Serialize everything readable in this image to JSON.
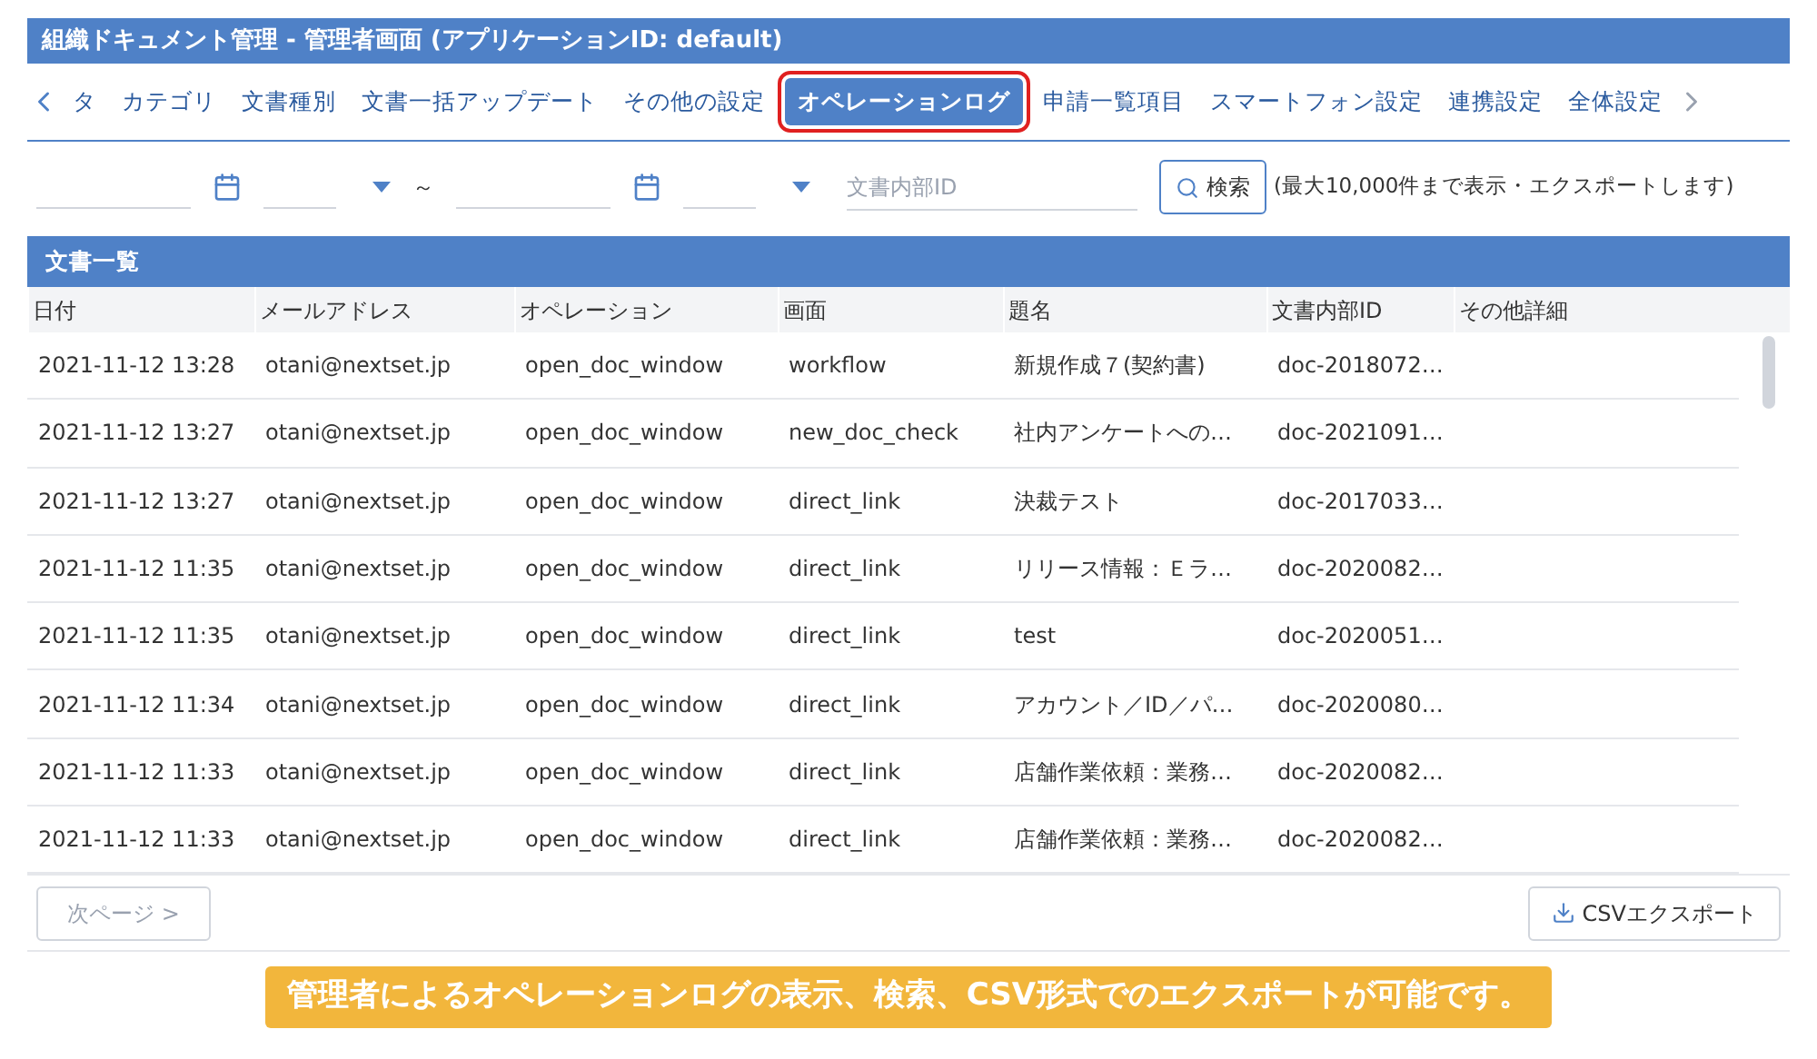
{
  "window": {
    "title": "組織ドキュメント管理 - 管理者画面 (アプリケーションID: default)"
  },
  "tabs": [
    {
      "label": "タ",
      "selected": false
    },
    {
      "label": "カテゴリ",
      "selected": false
    },
    {
      "label": "文書種別",
      "selected": false
    },
    {
      "label": "文書一括アップデート",
      "selected": false
    },
    {
      "label": "その他の設定",
      "selected": false
    },
    {
      "label": "オペレーションログ",
      "selected": true
    },
    {
      "label": "申請一覧項目",
      "selected": false
    },
    {
      "label": "スマートフォン設定",
      "selected": false
    },
    {
      "label": "連携設定",
      "selected": false
    },
    {
      "label": "全体設定",
      "selected": false
    }
  ],
  "filter": {
    "range_separator": "～",
    "doc_id": {
      "placeholder": "文書内部ID"
    },
    "search_button": "検索",
    "note": "(最大10,000件まで表示・エクスポートします)"
  },
  "table": {
    "title": "文書一覧",
    "columns": [
      "日付",
      "メールアドレス",
      "オペレーション",
      "画面",
      "題名",
      "文書内部ID",
      "その他詳細"
    ],
    "rows": [
      [
        "2021-11-12 13:28",
        "otani@nextset.jp",
        "open_doc_window",
        "workflow",
        "新規作成７(契約書)",
        "doc-2018072…"
      ],
      [
        "2021-11-12 13:27",
        "otani@nextset.jp",
        "open_doc_window",
        "new_doc_check",
        "社内アンケートへの…",
        "doc-2021091…"
      ],
      [
        "2021-11-12 13:27",
        "otani@nextset.jp",
        "open_doc_window",
        "direct_link",
        "決裁テスト",
        "doc-2017033…"
      ],
      [
        "2021-11-12 11:35",
        "otani@nextset.jp",
        "open_doc_window",
        "direct_link",
        "リリース情報：Ｅラ…",
        "doc-2020082…"
      ],
      [
        "2021-11-12 11:35",
        "otani@nextset.jp",
        "open_doc_window",
        "direct_link",
        "test",
        "doc-2020051…"
      ],
      [
        "2021-11-12 11:34",
        "otani@nextset.jp",
        "open_doc_window",
        "direct_link",
        "アカウント／ID／パ…",
        "doc-2020080…"
      ],
      [
        "2021-11-12 11:33",
        "otani@nextset.jp",
        "open_doc_window",
        "direct_link",
        "店舗作業依頼：業務…",
        "doc-2020082…"
      ],
      [
        "2021-11-12 11:33",
        "otani@nextset.jp",
        "open_doc_window",
        "direct_link",
        "店舗作業依頼：業務…",
        "doc-2020082…"
      ]
    ]
  },
  "footer": {
    "next_button": {
      "label": "次ページ >",
      "disabled": true
    },
    "export_button": "CSVエクスポート"
  },
  "caption": "管理者によるオペレーションログの表示、検索、CSV形式でのエクスポートが可能です。"
}
